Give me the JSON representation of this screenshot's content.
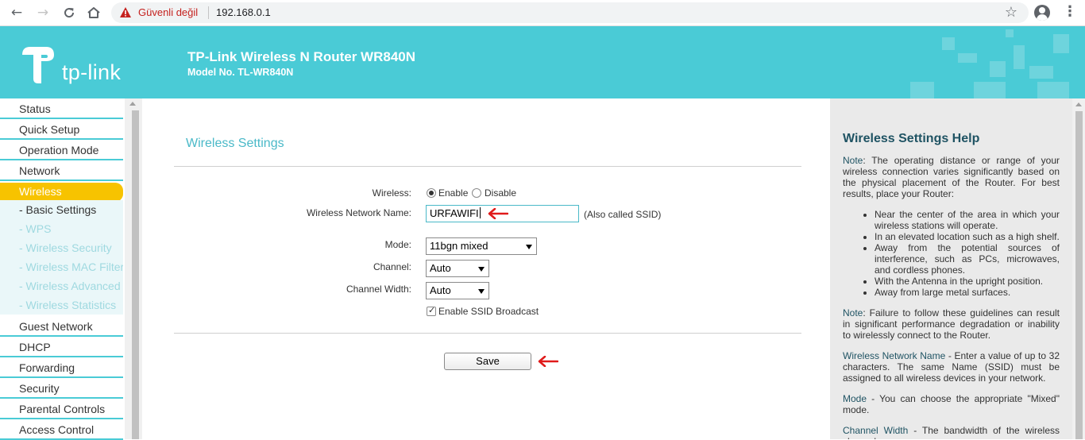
{
  "browser": {
    "security_warning": "Güvenli değil",
    "url": "192.168.0.1"
  },
  "header": {
    "logo_text": "tp-link",
    "title": "TP-Link Wireless N Router WR840N",
    "model": "Model No. TL-WR840N",
    "color": "#4acbd6"
  },
  "sidebar": {
    "items": [
      {
        "label": "Status"
      },
      {
        "label": "Quick Setup"
      },
      {
        "label": "Operation Mode"
      },
      {
        "label": "Network"
      },
      {
        "label": "Wireless"
      },
      {
        "label": "- Basic Settings"
      },
      {
        "label": "- WPS"
      },
      {
        "label": "- Wireless Security"
      },
      {
        "label": "- Wireless MAC Filtering"
      },
      {
        "label": "- Wireless Advanced"
      },
      {
        "label": "- Wireless Statistics"
      },
      {
        "label": "Guest Network"
      },
      {
        "label": "DHCP"
      },
      {
        "label": "Forwarding"
      },
      {
        "label": "Security"
      },
      {
        "label": "Parental Controls"
      },
      {
        "label": "Access Control"
      }
    ]
  },
  "main": {
    "title": "Wireless Settings",
    "wireless_label": "Wireless:",
    "enable_label": "Enable",
    "disable_label": "Disable",
    "ssid_label": "Wireless Network Name:",
    "ssid_value": "URFAWIFI",
    "ssid_note": "(Also called SSID)",
    "mode_label": "Mode:",
    "mode_value": "11bgn mixed",
    "channel_label": "Channel:",
    "channel_value": "Auto",
    "width_label": "Channel Width:",
    "width_value": "Auto",
    "broadcast_label": "Enable SSID Broadcast",
    "save_label": "Save"
  },
  "help": {
    "title": "Wireless Settings Help",
    "note1_head": "Note",
    "note1_text": ": The operating distance or range of your wireless connection varies significantly based on the physical placement of the Router. For best results, place your Router:",
    "bullets": [
      "Near the center of the area in which your wireless stations will operate.",
      "In an elevated location such as a high shelf.",
      "Away from the potential sources of interference, such as PCs, microwaves, and cordless phones.",
      "With the Antenna in the upright position.",
      "Away from large metal surfaces."
    ],
    "note2_head": "Note",
    "note2_text": ": Failure to follow these guidelines can result in significant performance degradation or inability to wirelessly connect to the Router.",
    "name_head": "Wireless Network Name",
    "name_text": " - Enter a value of up to 32 characters. The same Name (SSID) must be assigned to all wireless devices in your network.",
    "mode_head": "Mode",
    "mode_text": " - You can choose the appropriate \"Mixed\" mode.",
    "width_head": "Channel Width",
    "width_text": " - The bandwidth of the wireless channel."
  }
}
